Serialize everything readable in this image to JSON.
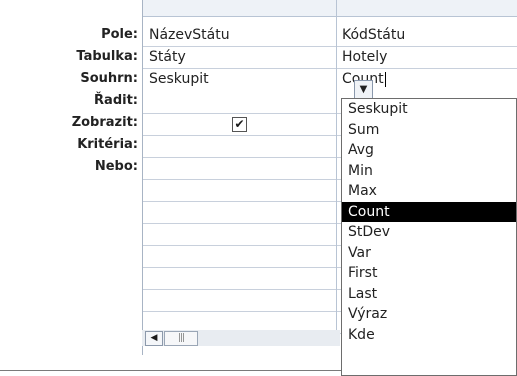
{
  "row_labels": [
    "Pole:",
    "Tabulka:",
    "Souhrn:",
    "Řadit:",
    "Zobrazit:",
    "Kritéria:",
    "Nebo:"
  ],
  "columns": [
    {
      "field": "NázevStátu",
      "table": "Státy",
      "total": "Seskupit",
      "show": true
    },
    {
      "field": "KódStátu",
      "table": "Hotely",
      "total": "Count"
    }
  ],
  "dropdown": {
    "options": [
      "Seskupit",
      "Sum",
      "Avg",
      "Min",
      "Max",
      "Count",
      "StDev",
      "Var",
      "First",
      "Last",
      "Výraz",
      "Kde"
    ],
    "selected": "Count"
  },
  "icons": {
    "dropdown_arrow": "chevron-down-icon",
    "scroll_left": "scroll-left-arrow-icon",
    "scroll_thumb": "scroll-thumb-grip-icon",
    "checkbox_mark": "checkmark-icon"
  },
  "colors": {
    "selected_bg": "#000000",
    "selected_fg": "#ffffff",
    "grid_line": "#c8d0dc"
  }
}
